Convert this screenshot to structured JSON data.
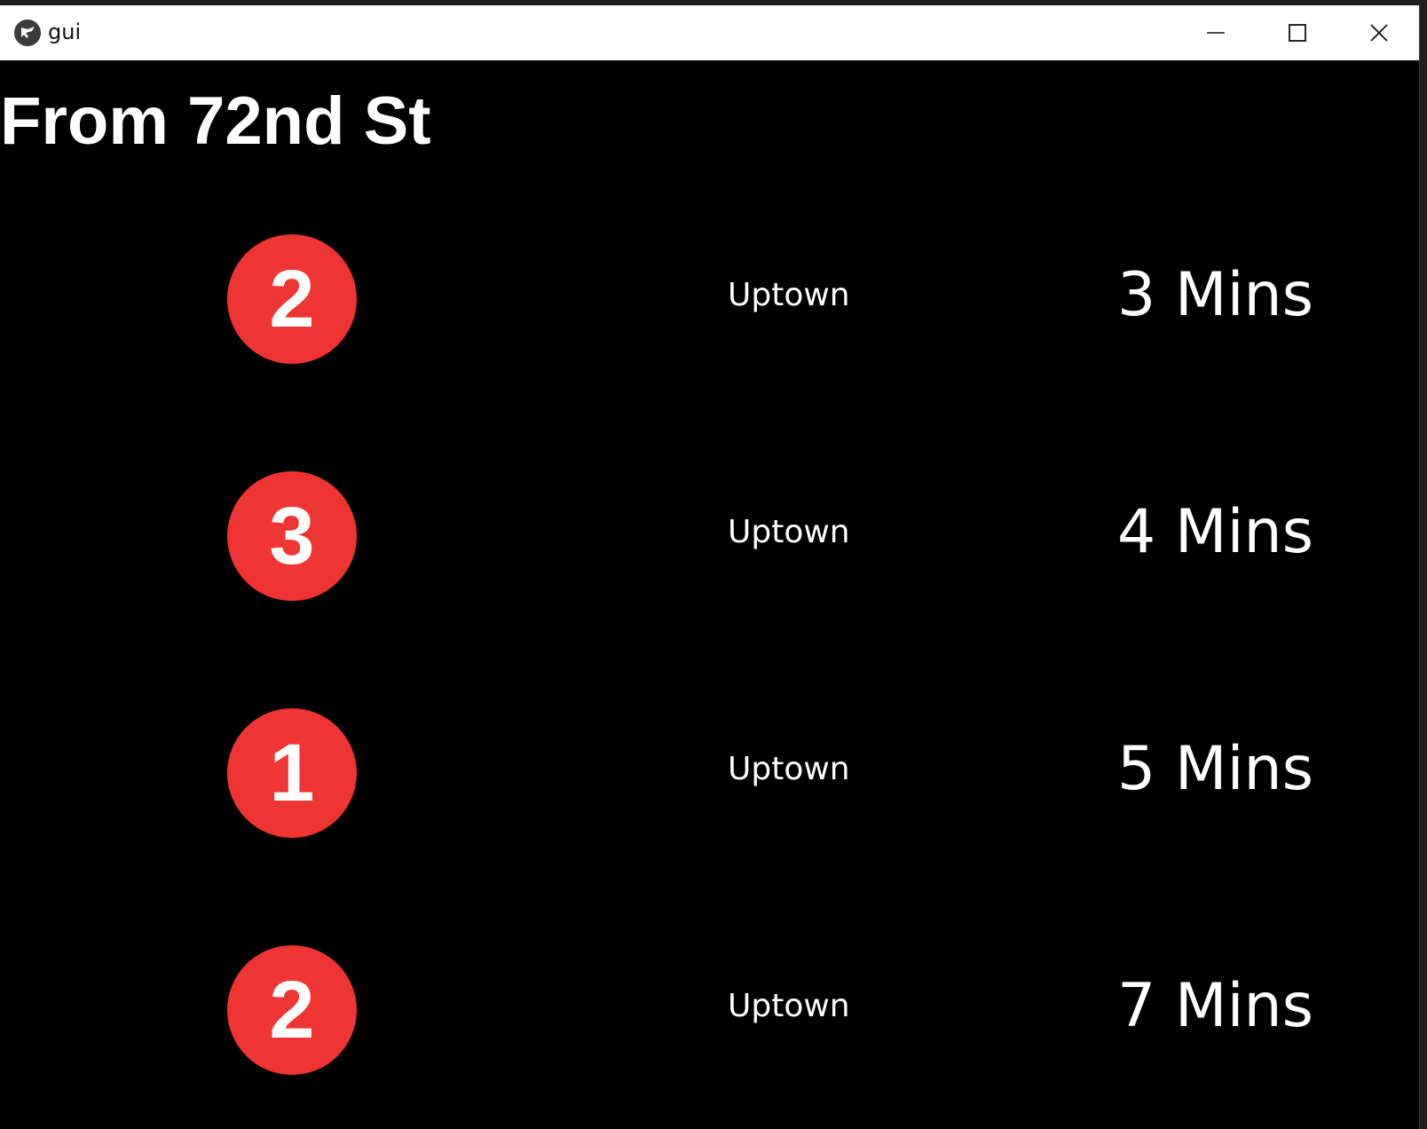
{
  "window": {
    "title": "gui",
    "icon": "kivy-app-icon",
    "controls": [
      "minimize-icon",
      "maximize-icon",
      "close-icon"
    ]
  },
  "station": {
    "title": "From 72nd St"
  },
  "colors": {
    "background": "#000000",
    "text": "#ffffff",
    "route_bullet": "#ee3533"
  },
  "arrivals": [
    {
      "route": "2",
      "direction": "Uptown",
      "eta": "3 Mins"
    },
    {
      "route": "3",
      "direction": "Uptown",
      "eta": "4 Mins"
    },
    {
      "route": "1",
      "direction": "Uptown",
      "eta": "5 Mins"
    },
    {
      "route": "2",
      "direction": "Uptown",
      "eta": "7 Mins"
    }
  ]
}
